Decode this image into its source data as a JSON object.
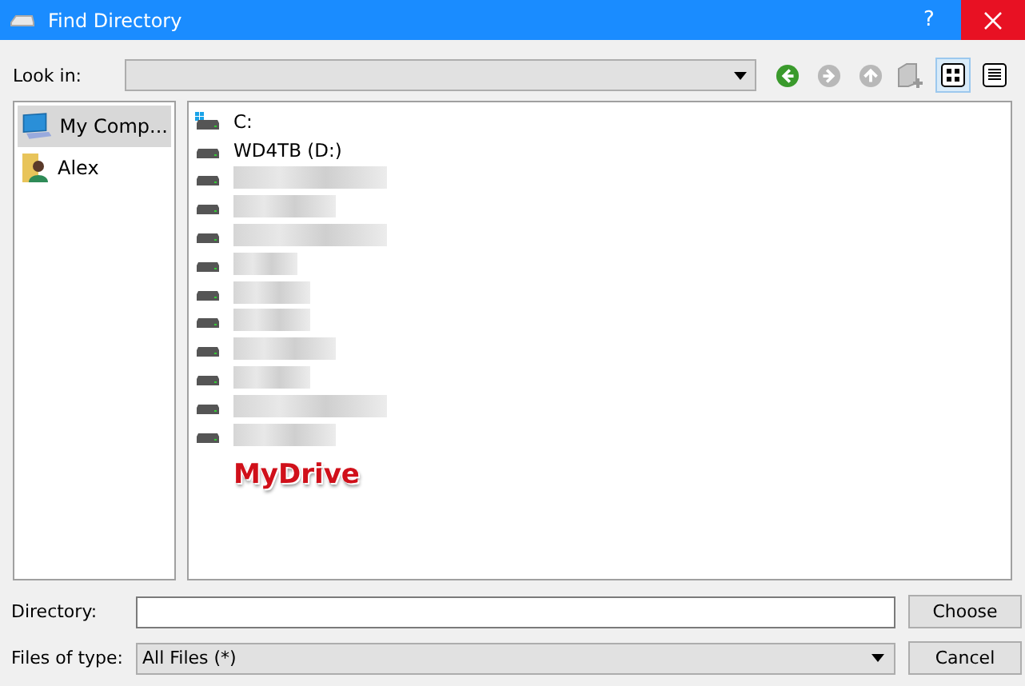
{
  "window": {
    "title": "Find Directory",
    "help": "?"
  },
  "look_in": {
    "label": "Look in:"
  },
  "toolbar": [
    {
      "kind": "back",
      "disabled": false
    },
    {
      "kind": "forward",
      "disabled": true
    },
    {
      "kind": "up",
      "disabled": true
    },
    {
      "kind": "new-folder",
      "disabled": true
    },
    {
      "kind": "icons-view",
      "selected": true
    },
    {
      "kind": "detail-view",
      "selected": false
    }
  ],
  "sidebar": {
    "items": [
      {
        "label": "My Comp...",
        "kind": "computer",
        "selected": true
      },
      {
        "label": "Alex",
        "kind": "user",
        "selected": false
      }
    ]
  },
  "files": [
    {
      "label": "C:",
      "kind": "system-drive",
      "redacted": false
    },
    {
      "label": "WD4TB (D:)",
      "kind": "drive",
      "redacted": false
    },
    {
      "kind": "drive",
      "redacted": true
    },
    {
      "kind": "drive",
      "redacted": true
    },
    {
      "kind": "drive",
      "redacted": true
    },
    {
      "kind": "drive",
      "redacted": true
    },
    {
      "kind": "drive",
      "redacted": true
    },
    {
      "kind": "drive",
      "redacted": true
    },
    {
      "kind": "drive",
      "redacted": true
    },
    {
      "kind": "drive",
      "redacted": true
    },
    {
      "kind": "drive",
      "redacted": true
    },
    {
      "kind": "drive",
      "redacted": true
    }
  ],
  "annotation": "MyDrive",
  "directory": {
    "label": "Directory:"
  },
  "file_type": {
    "label": "Files of type:",
    "value": "All Files (*)"
  },
  "buttons": [
    "Choose",
    "Cancel"
  ]
}
